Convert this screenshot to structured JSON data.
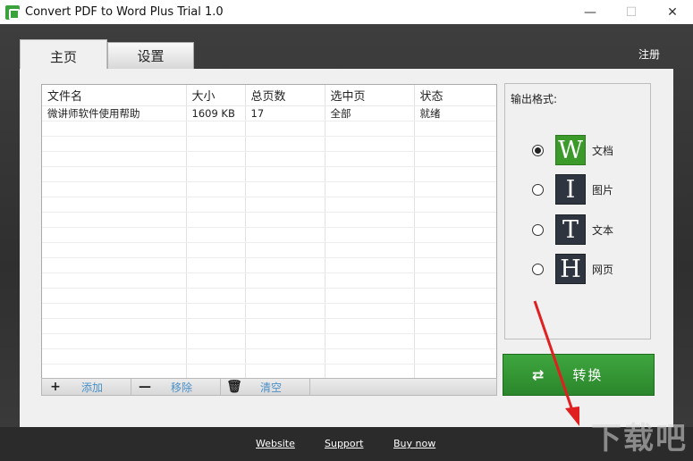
{
  "window": {
    "title": "Convert PDF to Word Plus Trial 1.0",
    "minimize_glyph": "—",
    "maximize_glyph": "☐",
    "close_glyph": "✕"
  },
  "tabs": [
    {
      "label": "主页",
      "active": true
    },
    {
      "label": "设置",
      "active": false
    }
  ],
  "register_label": "注册",
  "file_table": {
    "columns": [
      "文件名",
      "大小",
      "总页数",
      "选中页",
      "状态"
    ],
    "rows": [
      [
        "微讲师软件使用帮助",
        "1609 KB",
        "17",
        "全部",
        "就绪"
      ]
    ]
  },
  "toolbar": {
    "add": {
      "icon": "+",
      "label": "添加"
    },
    "remove": {
      "icon": "—",
      "label": "移除"
    },
    "clear": {
      "icon": "🗑",
      "label": "清空"
    }
  },
  "output_format": {
    "title": "输出格式:",
    "options": [
      {
        "letter": "W",
        "label": "文档",
        "selected": true
      },
      {
        "letter": "I",
        "label": "图片",
        "selected": false
      },
      {
        "letter": "T",
        "label": "文本",
        "selected": false
      },
      {
        "letter": "H",
        "label": "网页",
        "selected": false
      }
    ]
  },
  "convert": {
    "icon": "⇄",
    "label": "转换"
  },
  "footer": {
    "website": "Website",
    "support": "Support",
    "buy_now": "Buy now"
  },
  "watermark": "下载吧",
  "colors": {
    "accent_green": "#3ea63e",
    "dark_bg": "#2f2f2f",
    "link_blue": "#4a90c8",
    "arrow_red": "#e02020"
  }
}
